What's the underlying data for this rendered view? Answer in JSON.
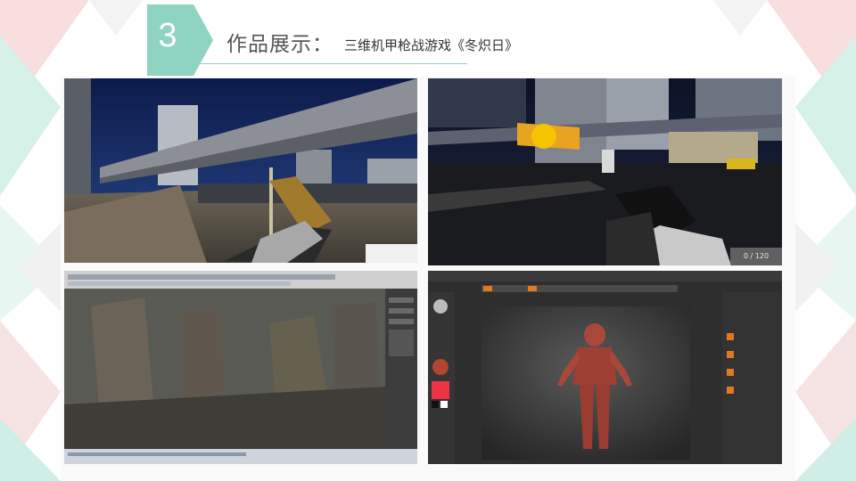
{
  "header": {
    "section_number": "3",
    "title": "作品展示：",
    "subtitle": "三维机甲枪战游戏《冬炽日》"
  },
  "gallery": {
    "counter": "0 / 120"
  },
  "colors": {
    "accent": "#8fd3c2",
    "deco_pink": "#f4c7c7",
    "deco_mint": "#cfeee5"
  }
}
